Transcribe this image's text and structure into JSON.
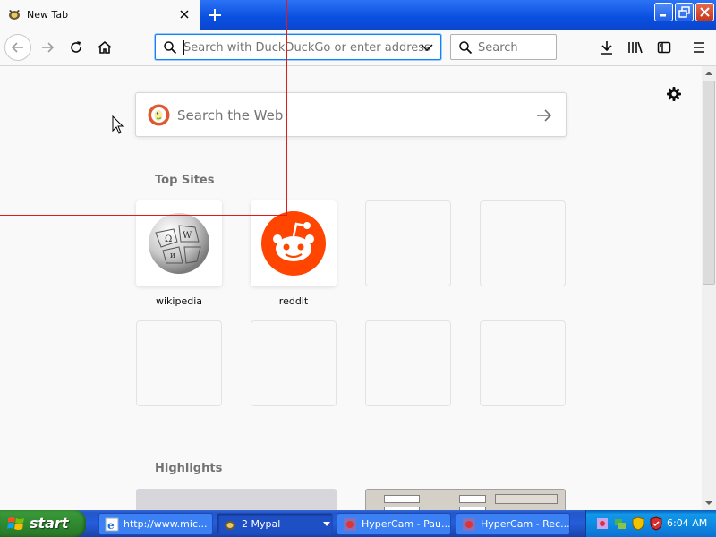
{
  "browser": {
    "tab_title": "New Tab",
    "url_placeholder": "Search with DuckDuckGo or enter address",
    "search_placeholder": "Search"
  },
  "newtab": {
    "web_search_placeholder": "Search the Web",
    "top_sites_heading": "Top Sites",
    "highlights_heading": "Highlights",
    "top_sites": [
      {
        "label": "wikipedia",
        "icon": "wikipedia-globe-icon"
      },
      {
        "label": "reddit",
        "icon": "reddit-alien-icon",
        "color": "#ff4500"
      }
    ]
  },
  "taskbar": {
    "start_label": "start",
    "tasks": [
      {
        "label": "http://www.mic...",
        "icon": "internet-explorer-icon"
      },
      {
        "label": "2 Mypal",
        "icon": "mypal-icon"
      },
      {
        "label": "HyperCam - Pau...",
        "icon": "hypercam-icon"
      },
      {
        "label": "HyperCam - Rec...",
        "icon": "hypercam-icon"
      }
    ],
    "clock": "6:04 AM"
  },
  "colors": {
    "accent": "#0a84ff",
    "xp_blue": "#245edb",
    "start_green": "#2f8a2f",
    "selection_red": "#e01b1b"
  }
}
